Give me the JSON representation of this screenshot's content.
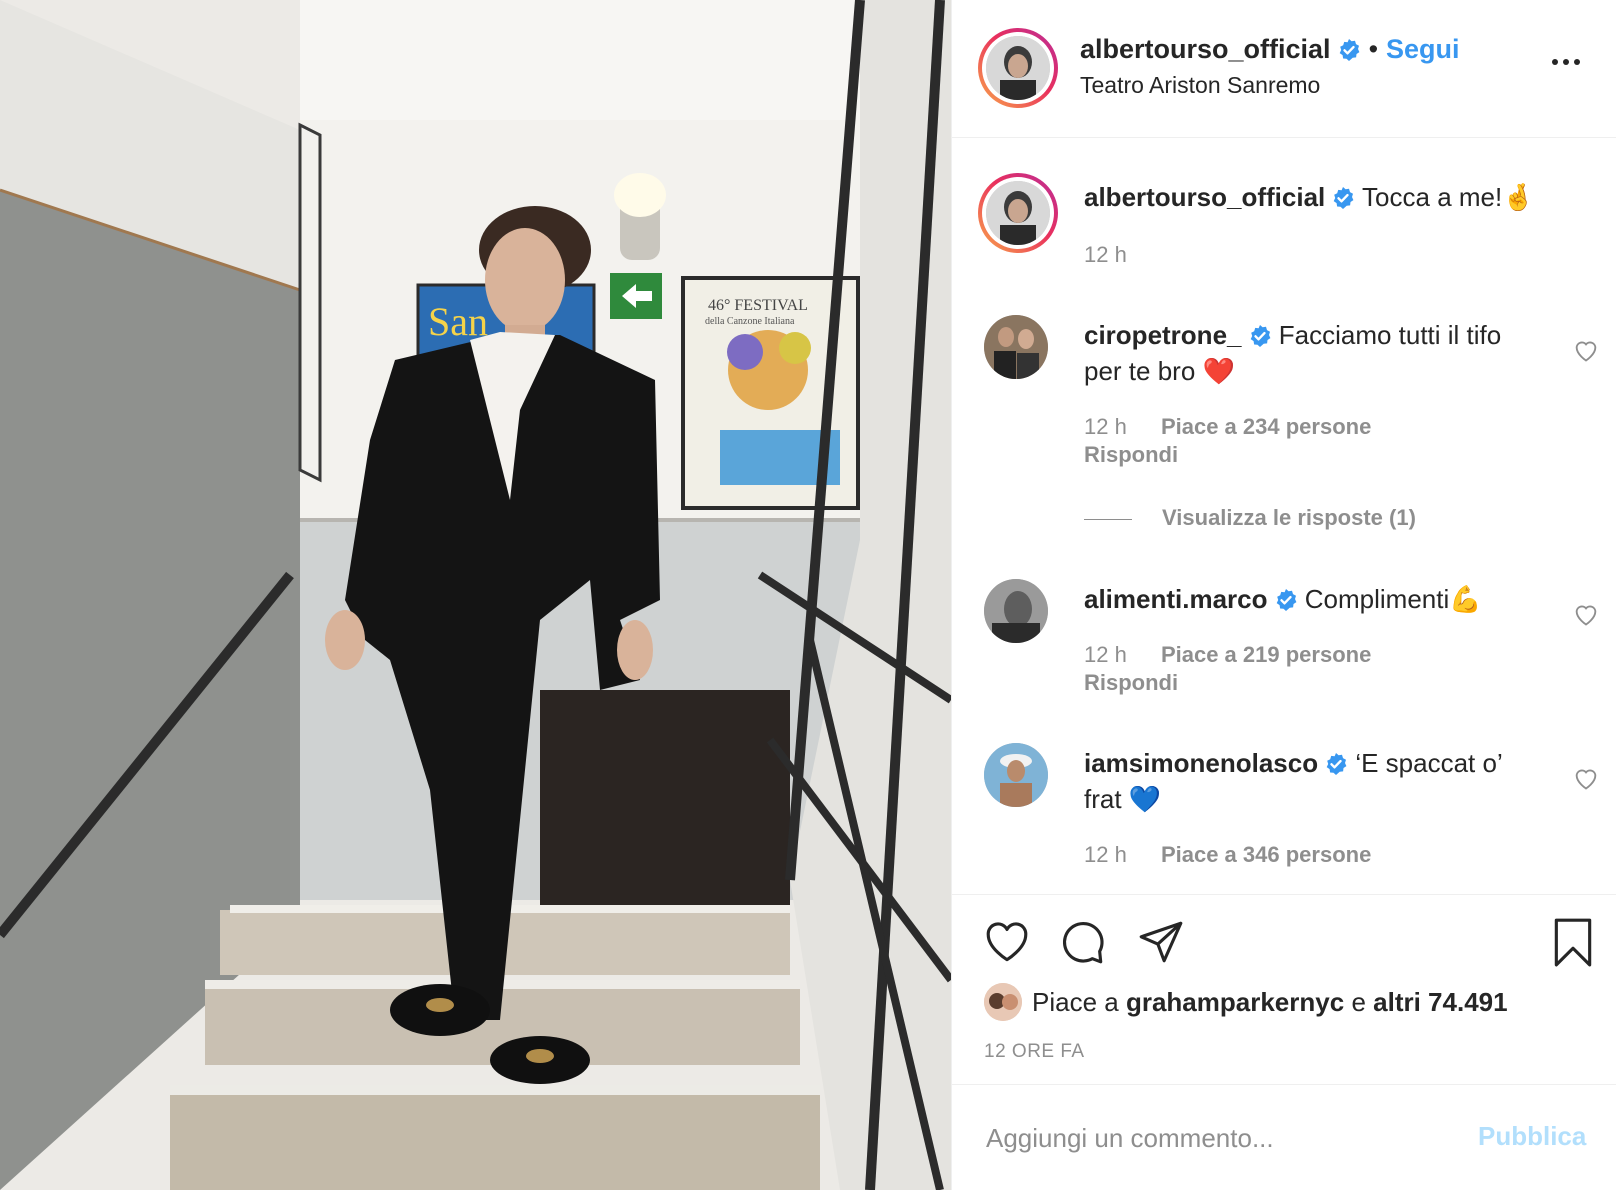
{
  "post": {
    "username": "albertourso_official",
    "follow_label": "Segui",
    "separator": "•",
    "location": "Teatro Ariston Sanremo",
    "more_icon": "more-options-icon"
  },
  "caption": {
    "username": "albertourso_official",
    "text": "Tocca a me!🤞",
    "time": "12 h"
  },
  "comments": [
    {
      "username": "ciropetrone_",
      "text": "Facciamo tutti il tifo per te bro ❤️",
      "time": "12 h",
      "likes": "Piace a 234 persone",
      "reply_label": "Rispondi",
      "view_replies": "Visualizza le risposte (1)"
    },
    {
      "username": "alimenti.marco",
      "text": "Complimenti💪",
      "time": "12 h",
      "likes": "Piace a 219 persone",
      "reply_label": "Rispondi"
    },
    {
      "username": "iamsimonenolasco",
      "text": "‘E spaccat o’ frat 💙",
      "time": "12 h",
      "likes": "Piace a 346 persone"
    }
  ],
  "likes_summary": {
    "prefix": "Piace a",
    "user": "grahamparkernyc",
    "joiner": "e",
    "others": "altri 74.491"
  },
  "posted_time": "12 ORE FA",
  "add_comment": {
    "placeholder": "Aggiungi un commento...",
    "publish_label": "Pubblica"
  },
  "photo_texts": {
    "poster_left": "San",
    "poster_center_line1": "46° FESTIVAL",
    "poster_center_line2": "della Canzone Italiana"
  },
  "colors": {
    "accent": "#3897f0",
    "publish_disabled": "#b2dffc",
    "verified": "#3897f0",
    "heart_red": "#ed4956",
    "muted": "#8e8e8e"
  }
}
